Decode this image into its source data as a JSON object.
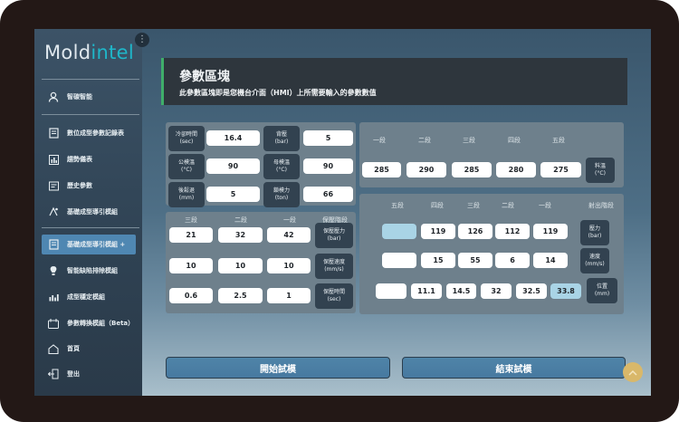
{
  "app": {
    "logo_prefix": "Mold",
    "logo_suffix": "intel"
  },
  "sidebar": {
    "items": [
      {
        "label": "智碳智能",
        "icon": "user-icon"
      },
      {
        "label": "數位成型參數記錄表",
        "icon": "document-icon"
      },
      {
        "label": "趨勢儀表",
        "icon": "chart-icon"
      },
      {
        "label": "歷史參數",
        "icon": "history-icon"
      },
      {
        "label": "基礎成型導引模組",
        "icon": "guide-icon"
      },
      {
        "label": "基礎成型導引模組 +",
        "icon": "document-icon"
      },
      {
        "label": "智能缺陷排除模組",
        "icon": "bulb-icon"
      },
      {
        "label": "成型穩定模組",
        "icon": "bar-chart-icon"
      },
      {
        "label": "參數轉換模組（Beta）",
        "icon": "convert-icon"
      },
      {
        "label": "首頁",
        "icon": "home-icon"
      },
      {
        "label": "登出",
        "icon": "logout-icon"
      }
    ],
    "active_index": 5
  },
  "header": {
    "title": "參數區塊",
    "subtitle": "此參數區塊即是您機台介面（HMI）上所需要輸入的參數數值"
  },
  "basic": [
    {
      "label": "冷卻時間\n(sec)",
      "value": "16.4"
    },
    {
      "label": "背壓\n(bar)",
      "value": "5"
    },
    {
      "label": "公模溫\n(°C)",
      "value": "90"
    },
    {
      "label": "母模溫\n(°C)",
      "value": "90"
    },
    {
      "label": "後鬆退\n(mm)",
      "value": "5"
    },
    {
      "label": "鎖模力\n(ton)",
      "value": "66"
    }
  ],
  "barrel": {
    "headers": [
      "一段",
      "二段",
      "三段",
      "四段",
      "五段"
    ],
    "values": [
      "285",
      "290",
      "285",
      "280",
      "275"
    ],
    "label": "料溫\n(°C)"
  },
  "holding": {
    "headers": [
      "三段",
      "二段",
      "一段",
      "保壓階段"
    ],
    "rows": [
      {
        "values": [
          "21",
          "32",
          "42"
        ],
        "label": "保壓壓力\n(bar)"
      },
      {
        "values": [
          "10",
          "10",
          "10"
        ],
        "label": "保壓速度\n(mm/s)"
      },
      {
        "values": [
          "0.6",
          "2.5",
          "1"
        ],
        "label": "保壓時間\n(sec)"
      }
    ]
  },
  "injection": {
    "headers": [
      "五段",
      "四段",
      "三段",
      "二段",
      "一段",
      "射出階段"
    ],
    "pressure": {
      "values": [
        "",
        "119",
        "126",
        "112",
        "119"
      ],
      "label": "壓力\n(bar)"
    },
    "speed": {
      "values": [
        "",
        "15",
        "55",
        "6",
        "14"
      ],
      "label": "速度\n(mm/s)"
    },
    "position": {
      "values": [
        "",
        "11.1",
        "14.5",
        "32",
        "32.5",
        "33.8"
      ],
      "label": "位置\n(mm)"
    }
  },
  "actions": {
    "start": "開始試模",
    "end": "結束試模"
  }
}
